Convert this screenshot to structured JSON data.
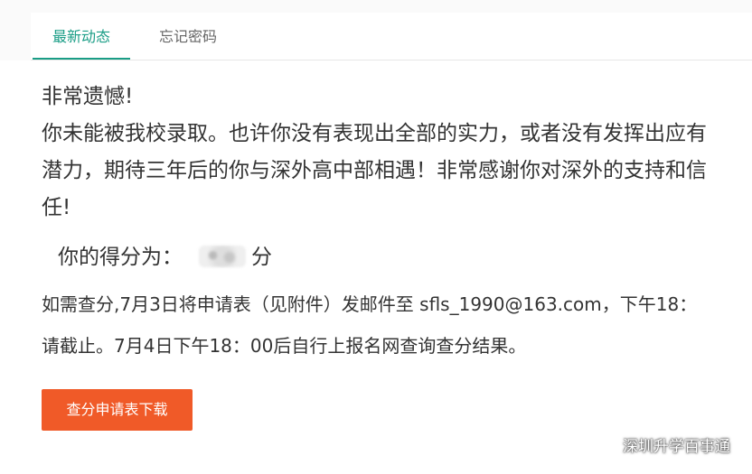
{
  "tabs": [
    {
      "label": "最新动态",
      "active": true
    },
    {
      "label": "忘记密码",
      "active": false
    }
  ],
  "message": {
    "line1": "非常遗憾!",
    "line2": "你未能被我校录取。也许你没有表现出全部的实力，或者没有发挥出应有",
    "line3": "潜力，期待三年后的你与深外高中部相遇！非常感谢你对深外的支持和信",
    "line4": "任!"
  },
  "score": {
    "label": "你的得分为：",
    "unit": "分"
  },
  "info": {
    "line1": "如需查分,7月3日将申请表（见附件）发邮件至 sfls_1990@163.com，下午18：",
    "line2": "请截止。7月4日下午18：00后自行上报名网查询查分结果。"
  },
  "download_button": {
    "label": "查分申请表下载"
  },
  "watermark": {
    "text": "深圳升学百事通",
    "icon": "wechat-icon"
  },
  "colors": {
    "accent": "#1a9d86",
    "button": "#f05a28"
  }
}
